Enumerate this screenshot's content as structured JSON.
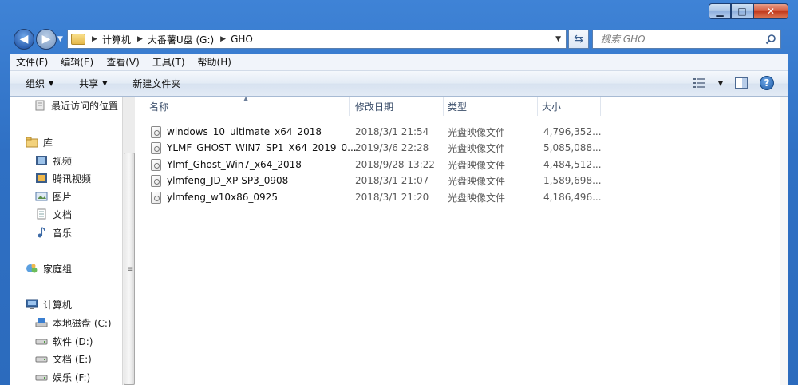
{
  "window": {
    "caption": {
      "minimize": "▁",
      "maximize": "□",
      "close": "✕"
    }
  },
  "address": {
    "segments": [
      "计算机",
      "大番薯U盘 (G:)",
      "GHO"
    ]
  },
  "search": {
    "placeholder": "搜索 GHO"
  },
  "menu": [
    "文件(F)",
    "编辑(E)",
    "查看(V)",
    "工具(T)",
    "帮助(H)"
  ],
  "commands": {
    "organize": "组织",
    "share": "共享",
    "new_folder": "新建文件夹"
  },
  "nav": {
    "recent": "最近访问的位置",
    "libraries": "库",
    "lib_items": [
      "视频",
      "腾讯视频",
      "图片",
      "文档",
      "音乐"
    ],
    "homegroup": "家庭组",
    "computer": "计算机",
    "drives": [
      "本地磁盘 (C:)",
      "软件 (D:)",
      "文档 (E:)",
      "娱乐 (F:)"
    ]
  },
  "columns": {
    "name": "名称",
    "date": "修改日期",
    "type": "类型",
    "size": "大小"
  },
  "files": [
    {
      "name": "windows_10_ultimate_x64_2018",
      "date": "2018/3/1 21:54",
      "type": "光盘映像文件",
      "size": "4,796,352..."
    },
    {
      "name": "YLMF_GHOST_WIN7_SP1_X64_2019_0...",
      "date": "2019/3/6 22:28",
      "type": "光盘映像文件",
      "size": "5,085,088..."
    },
    {
      "name": "Ylmf_Ghost_Win7_x64_2018",
      "date": "2018/9/28 13:22",
      "type": "光盘映像文件",
      "size": "4,484,512..."
    },
    {
      "name": "ylmfeng_JD_XP-SP3_0908",
      "date": "2018/3/1 21:07",
      "type": "光盘映像文件",
      "size": "1,589,698..."
    },
    {
      "name": "ylmfeng_w10x86_0925",
      "date": "2018/3/1 21:20",
      "type": "光盘映像文件",
      "size": "4,186,496..."
    }
  ],
  "colors": {
    "titlebar": "#2f70c4",
    "accent": "#1d5aa6"
  }
}
